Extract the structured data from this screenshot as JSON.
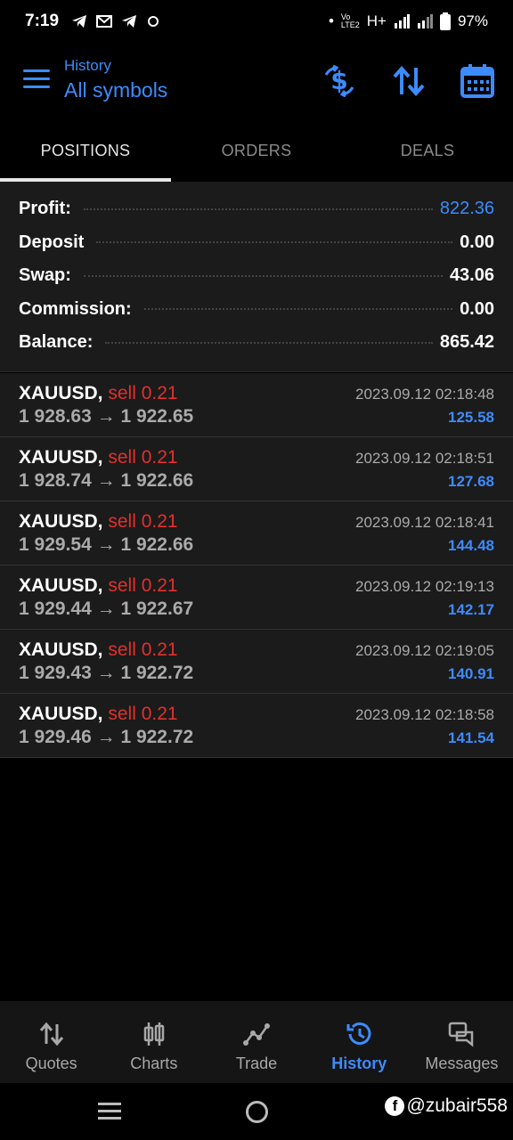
{
  "status_bar": {
    "time": "7:19",
    "network": "H+",
    "battery": "97%"
  },
  "header": {
    "subtitle": "History",
    "title": "All symbols"
  },
  "tabs": [
    {
      "label": "POSITIONS",
      "active": true
    },
    {
      "label": "ORDERS",
      "active": false
    },
    {
      "label": "DEALS",
      "active": false
    }
  ],
  "summary": [
    {
      "label": "Profit:",
      "value": "822.36",
      "highlight": true
    },
    {
      "label": "Deposit",
      "value": "0.00",
      "highlight": false
    },
    {
      "label": "Swap:",
      "value": "43.06",
      "highlight": false
    },
    {
      "label": "Commission:",
      "value": "0.00",
      "highlight": false
    },
    {
      "label": "Balance:",
      "value": "865.42",
      "highlight": false
    }
  ],
  "deals": [
    {
      "symbol": "XAUUSD,",
      "side": "sell 0.21",
      "open": "1 928.63",
      "arrow": "→",
      "close": "1 922.65",
      "time": "2023.09.12 02:18:48",
      "profit": "125.58"
    },
    {
      "symbol": "XAUUSD,",
      "side": "sell 0.21",
      "open": "1 928.74",
      "arrow": "→",
      "close": "1 922.66",
      "time": "2023.09.12 02:18:51",
      "profit": "127.68"
    },
    {
      "symbol": "XAUUSD,",
      "side": "sell 0.21",
      "open": "1 929.54",
      "arrow": "→",
      "close": "1 922.66",
      "time": "2023.09.12 02:18:41",
      "profit": "144.48"
    },
    {
      "symbol": "XAUUSD,",
      "side": "sell 0.21",
      "open": "1 929.44",
      "arrow": "→",
      "close": "1 922.67",
      "time": "2023.09.12 02:19:13",
      "profit": "142.17"
    },
    {
      "symbol": "XAUUSD,",
      "side": "sell 0.21",
      "open": "1 929.43",
      "arrow": "→",
      "close": "1 922.72",
      "time": "2023.09.12 02:19:05",
      "profit": "140.91"
    },
    {
      "symbol": "XAUUSD,",
      "side": "sell 0.21",
      "open": "1 929.46",
      "arrow": "→",
      "close": "1 922.72",
      "time": "2023.09.12 02:18:58",
      "profit": "141.54"
    }
  ],
  "bottom_nav": [
    {
      "label": "Quotes",
      "icon": "quotes-icon",
      "active": false
    },
    {
      "label": "Charts",
      "icon": "charts-icon",
      "active": false
    },
    {
      "label": "Trade",
      "icon": "trade-icon",
      "active": false
    },
    {
      "label": "History",
      "icon": "history-icon",
      "active": true
    },
    {
      "label": "Messages",
      "icon": "messages-icon",
      "active": false
    }
  ],
  "watermark": "@zubair558",
  "colors": {
    "accent": "#3d8bfd",
    "sell": "#e2302c",
    "panel": "#1b1b1b",
    "background": "#000000"
  }
}
